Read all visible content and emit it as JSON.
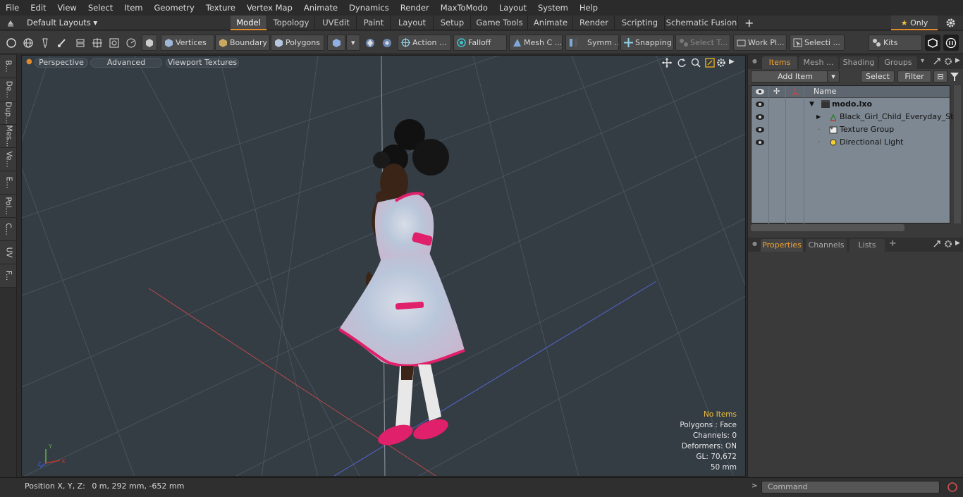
{
  "menu": [
    "File",
    "Edit",
    "View",
    "Select",
    "Item",
    "Geometry",
    "Texture",
    "Vertex Map",
    "Animate",
    "Dynamics",
    "Render",
    "MaxToModo",
    "Layout",
    "System",
    "Help"
  ],
  "layout_selector": "Default Layouts",
  "layout_tabs": [
    "Model",
    "Topology",
    "UVEdit",
    "Paint",
    "Layout",
    "Setup",
    "Game Tools",
    "Animate",
    "Render",
    "Scripting",
    "Schematic Fusion"
  ],
  "layout_active": "Model",
  "add_tab_glyph": "+",
  "only_label": "Only",
  "toolbar": {
    "vertices": "Vertices",
    "boundary": "Boundary",
    "polygons": "Polygons",
    "action": "Action",
    "falloff": "Falloff",
    "mesh": "Mesh C ...",
    "symm": "Symm ...",
    "snapping": "Snapping",
    "select_t": "Select T...",
    "work_pl": "Work Pl...",
    "selecti": "Selecti ...",
    "kits": "Kits"
  },
  "left_tabs": [
    "B...",
    "De...",
    "Dup...",
    "Mes...",
    "Ve...",
    "E...",
    "Pol...",
    "C...",
    "UV",
    "F..."
  ],
  "viewport": {
    "buttons": [
      "Perspective",
      "Advanced",
      "Viewport Textures"
    ],
    "hud": {
      "selection": "No Items",
      "polygons": "Polygons : Face",
      "channels": "Channels: 0",
      "deformers": "Deformers: ON",
      "gl": "GL: 70,672",
      "scale": "50 mm"
    },
    "axis_labels": {
      "y": "Y",
      "x": "X",
      "z": "Z"
    }
  },
  "status": {
    "position_label": "Position X, Y, Z:",
    "position_value": "0 m, 292 mm, -652 mm"
  },
  "items_panel": {
    "tabs": [
      "Items",
      "Mesh ...",
      "Shading",
      "Groups"
    ],
    "active_tab": "Items",
    "add_item": "Add Item",
    "select": "Select",
    "filter": "Filter",
    "column_name": "Name",
    "tree": [
      {
        "label": "modo.lxo",
        "bold": true
      },
      {
        "label": "Black_Girl_Child_Everyday_St..."
      },
      {
        "label": "Texture Group"
      },
      {
        "label": "Directional Light"
      }
    ]
  },
  "properties_panel": {
    "tabs": [
      "Properties",
      "Channels",
      "Lists"
    ],
    "active_tab": "Properties",
    "add_glyph": "+"
  },
  "command": {
    "placeholder": "Command"
  },
  "colors": {
    "accent": "#e08a2c",
    "viewport_bg": "#343c44",
    "hud_highlight": "#f0c040",
    "dress_trim": "#e0206a"
  }
}
